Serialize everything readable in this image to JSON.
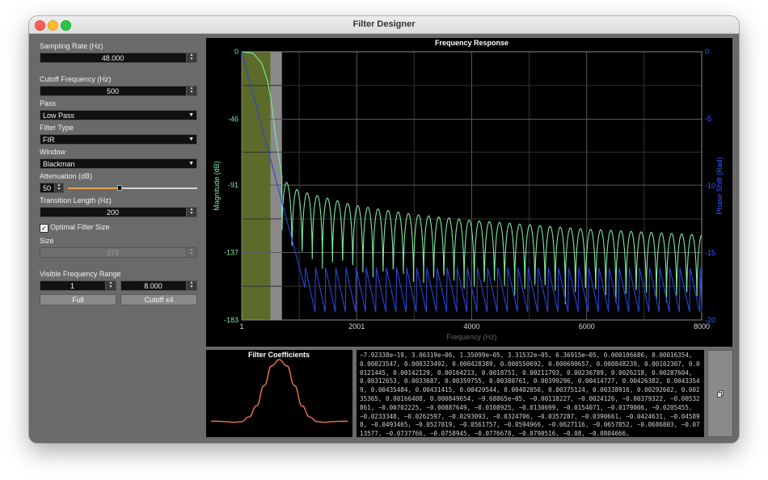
{
  "window": {
    "title": "Filter Designer"
  },
  "sidebar": {
    "sampling_rate": {
      "label": "Sampling Rate (Hz)",
      "value": "48.000"
    },
    "cutoff": {
      "label": "Cutoff Frequency (Hz)",
      "value": "500"
    },
    "pass": {
      "label": "Pass",
      "value": "Low Pass"
    },
    "filter_type": {
      "label": "Filter Type",
      "value": "FIR"
    },
    "window": {
      "label": "Window",
      "value": "Blackman"
    },
    "attenuation": {
      "label": "Attenuation (dB)",
      "value": "50",
      "slider_fraction": 0.4
    },
    "transition": {
      "label": "Transition Length (Hz)",
      "value": "200"
    },
    "optimal": {
      "label": "Optimal Filter Size",
      "checked": true,
      "check_glyph": "✓"
    },
    "size": {
      "label": "Size",
      "value": "273"
    },
    "visible_range": {
      "label": "Visible Frequency Range",
      "min": "1",
      "max": "8.000"
    },
    "full_button": "Full",
    "cutoff_button": "Cutoff x4"
  },
  "chart_data": {
    "type": "line",
    "title": "Frequency Response",
    "xlabel": "Frequency (Hz)",
    "ylabel": "Magnitude (dB)",
    "y2label": "Phase Shift (Rad)",
    "xlim": [
      1,
      8000
    ],
    "ylim": [
      -183,
      0
    ],
    "y2lim": [
      -20,
      0
    ],
    "x_ticks": [
      "1",
      "2001",
      "4000",
      "6000",
      "8000"
    ],
    "y_ticks": [
      "0",
      "-46",
      "-91",
      "-137",
      "-183"
    ],
    "y2_ticks": [
      "0",
      "-5",
      "-10",
      "-15",
      "-20"
    ],
    "grid": true,
    "passband": {
      "from": 1,
      "to": 500
    },
    "transition_band": {
      "from": 500,
      "to": 700
    },
    "colors": {
      "magnitude": "#7fe8a0",
      "phase": "#2a45d8",
      "passband": "#5c6b2a",
      "transition": "#8a8a8a"
    },
    "series": [
      {
        "name": "Magnitude (dB)",
        "x": [
          1,
          200,
          350,
          450,
          500,
          550,
          600,
          700,
          800,
          1000,
          2000,
          3000,
          4000,
          5000,
          6000,
          7000,
          8000
        ],
        "values": [
          0,
          -1,
          -8,
          -20,
          -30,
          -45,
          -60,
          -85,
          -90,
          -95,
          -105,
          -111,
          -115,
          -118,
          -121,
          -123,
          -125
        ]
      },
      {
        "name": "Phase Shift (Rad)",
        "x": [
          1,
          1100,
          8000
        ],
        "values": [
          0,
          -17.6,
          -17
        ]
      }
    ]
  },
  "coef_chart": {
    "type": "line",
    "title": "Filter Coefficients",
    "color": "#f07050",
    "values": [
      0,
      0,
      -0.004,
      -0.016,
      -0.006,
      0.07,
      0.25,
      0.58,
      0.9,
      1.0,
      0.9,
      0.58,
      0.25,
      0.07,
      -0.006,
      -0.016,
      -0.004,
      0,
      0
    ]
  },
  "coefficients_text": "−7.92338e−19, 3.06319e−06, 1.35099e−05, 3.31532e−05, 6.36915e−05, 0.000106686, 0.00016354, 0.00023547, 0.000323492, 0.000428389, 0.000550692, 0.000690657, 0.000848239, 0.00102307, 0.00121445, 0.00142129, 0.00164213, 0.0018751, 0.00211793, 0.00236789, 0.0026218, 0.00287604, 0.00312653, 0.0033687, 0.00359755, 0.00380761, 0.00399296, 0.00414727, 0.00426382, 0.00433549, 0.00435484, 0.00431415, 0.00420544, 0.00402056, 0.00375124, 0.00338916, 0.00292602, 0.00235365, 0.00166408, 0.000849654, −9.68865e−05, −0.00118227, −0.0024126, −0.00379322, −0.00532861, −0.00702225, −0.00887649, −0.0108925, −0.0130699, −0.0154071, −0.0179006, −0.0205455, −0.0233348, −0.0262597, −0.0293093, −0.0324706, −0.0357287, −0.0390661, −0.0424631, −0.045898, −0.0493465, −0.0527819, −0.0561757, −0.0594966, −0.0627116, −0.0657852, −0.0686803, −0.0713577, −0.0737766, −0.0758945, −0.0776678, −0.0790516, −0.08, −0.0804666,",
  "copy_button_icon": "copy-icon"
}
